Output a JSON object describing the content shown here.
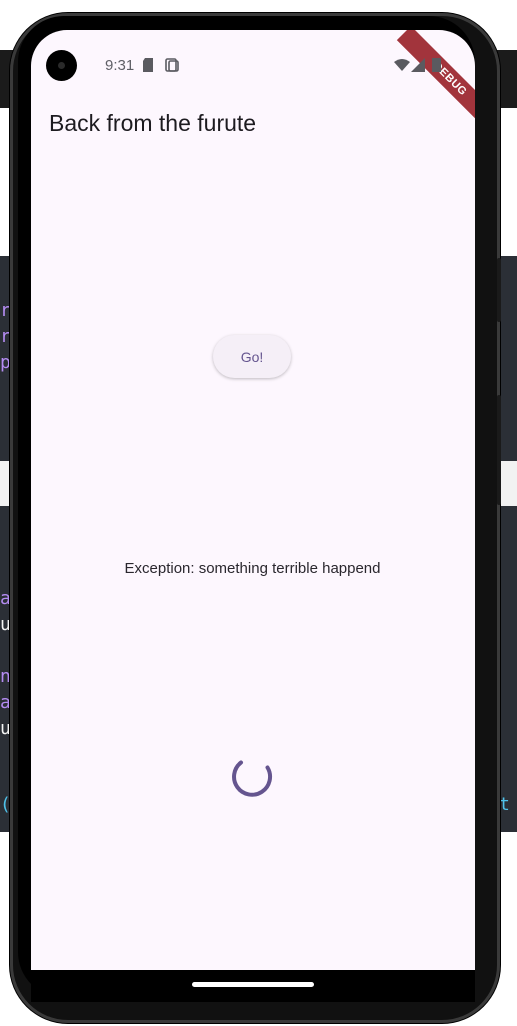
{
  "status_bar": {
    "time": "9:31",
    "icons": [
      "sd-card-icon",
      "screenshot-icon",
      "wifi-icon",
      "signal-icon",
      "battery-icon"
    ]
  },
  "debug_banner": {
    "label": "DEBUG",
    "color": "#a2343c"
  },
  "app_bar": {
    "title": "Back from the furute"
  },
  "main": {
    "go_button_label": "Go!",
    "exception_message": "Exception: something terrible happend",
    "loading_indicator": "circular-progress-icon"
  },
  "colors": {
    "screen_background": "#fdf7fe",
    "primary": "#65558f",
    "button_background": "#f5eff7"
  },
  "background_code": {
    "left_chars": [
      "r",
      "r",
      "p",
      "",
      "",
      "",
      "(",
      "a",
      "u",
      "",
      "n",
      "a",
      "u"
    ],
    "right_char": "t",
    "left_bottom": "("
  }
}
